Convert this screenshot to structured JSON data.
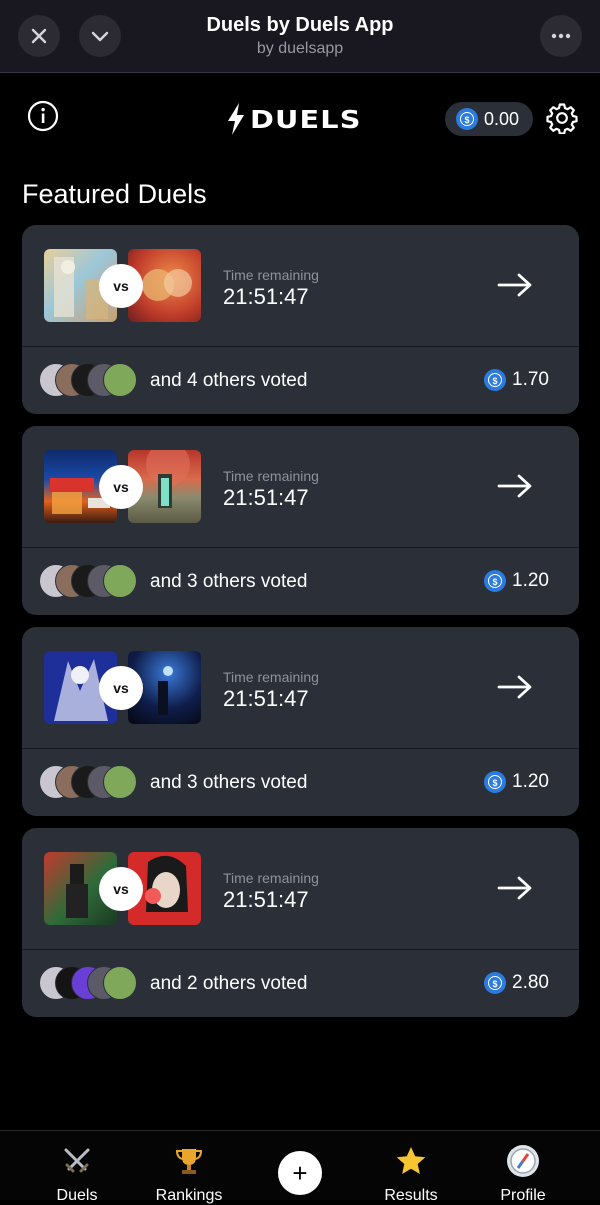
{
  "window": {
    "title": "Duels by Duels App",
    "subtitle": "by duelsapp"
  },
  "header": {
    "logo_text": "DUELS",
    "balance": "0.00"
  },
  "featured": {
    "title": "Featured Duels",
    "time_label": "Time remaining",
    "vs_label": "vs",
    "duels": [
      {
        "time": "21:51:47",
        "voters_text": "and 4 others voted",
        "prize": "1.70"
      },
      {
        "time": "21:51:47",
        "voters_text": "and 3 others voted",
        "prize": "1.20"
      },
      {
        "time": "21:51:47",
        "voters_text": "and 3 others voted",
        "prize": "1.20"
      },
      {
        "time": "21:51:47",
        "voters_text": "and 2 others voted",
        "prize": "2.80"
      }
    ]
  },
  "nav": {
    "items": [
      {
        "label": "Duels",
        "icon": "crossed-swords-icon"
      },
      {
        "label": "Rankings",
        "icon": "trophy-icon"
      },
      {
        "label": "+",
        "icon": "plus-icon"
      },
      {
        "label": "Results",
        "icon": "star-icon"
      },
      {
        "label": "Profile",
        "icon": "compass-icon"
      }
    ]
  },
  "colors": {
    "background": "#000000",
    "card": "#2a2f38",
    "coin": "#2b7be0",
    "topbar": "#19171f"
  }
}
